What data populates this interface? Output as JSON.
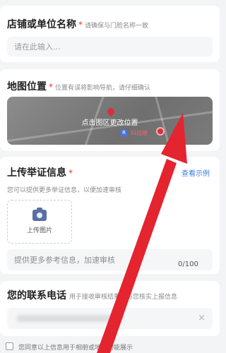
{
  "store_name": {
    "title": "店铺或单位名称",
    "required_mark": "*",
    "hint": "请确保与门脸名称一致",
    "placeholder": "请在此输入..."
  },
  "map_location": {
    "title": "地图位置",
    "required_mark": "*",
    "hint": "位置有误将影响导航，请仔细确认",
    "overlay_label": "点击图区更改位置",
    "poi_label": "科技楼"
  },
  "evidence": {
    "title": "上传举证信息",
    "required_mark": "*",
    "link": "查看示例",
    "subtitle": "您可以提供更多举证信息，以便加速审核",
    "upload_label": "上传图片",
    "textarea_placeholder": "提供更多参考信息，加速审核",
    "counter": "0/100"
  },
  "phone": {
    "title": "您的联系电话",
    "hint": "用于接收审核结果及与您核实上报信息",
    "clear_icon": "×"
  },
  "agreement": {
    "text": "您同意以上信息用于相册或地图功能展示"
  },
  "colors": {
    "required": "#e33333",
    "link": "#3a7be0",
    "arrow": "#e4242f"
  }
}
